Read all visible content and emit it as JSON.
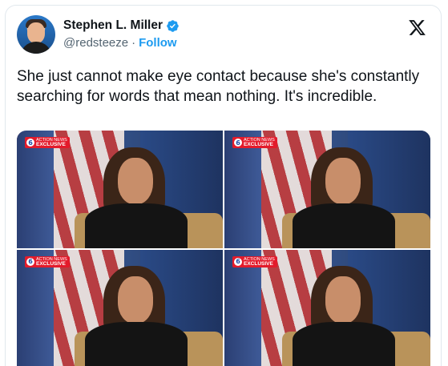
{
  "author": {
    "name": "Stephen L. Miller",
    "handle": "@redsteeze",
    "separator": "·",
    "follow_label": "Follow",
    "verified": true,
    "avatar_icon": "avatar-photo"
  },
  "platform": {
    "logo_icon": "x-logo-icon"
  },
  "post": {
    "text": "She just cannot make eye contact because she's constantly searching for words that mean nothing. It's incredible."
  },
  "media": {
    "images": [
      {
        "badge_line1": "ACTION NEWS",
        "badge_line2": "EXCLUSIVE",
        "badge_logo": "6"
      },
      {
        "badge_line1": "ACTION NEWS",
        "badge_line2": "EXCLUSIVE",
        "badge_logo": "6"
      },
      {
        "badge_line1": "ACTION NEWS",
        "badge_line2": "EXCLUSIVE",
        "badge_logo": "6"
      },
      {
        "badge_line1": "ACTION NEWS",
        "badge_line2": "EXCLUSIVE",
        "badge_logo": "6"
      }
    ]
  },
  "colors": {
    "accent": "#1d9bf0",
    "secondary_text": "#536471",
    "badge_red": "#e31b2b"
  }
}
